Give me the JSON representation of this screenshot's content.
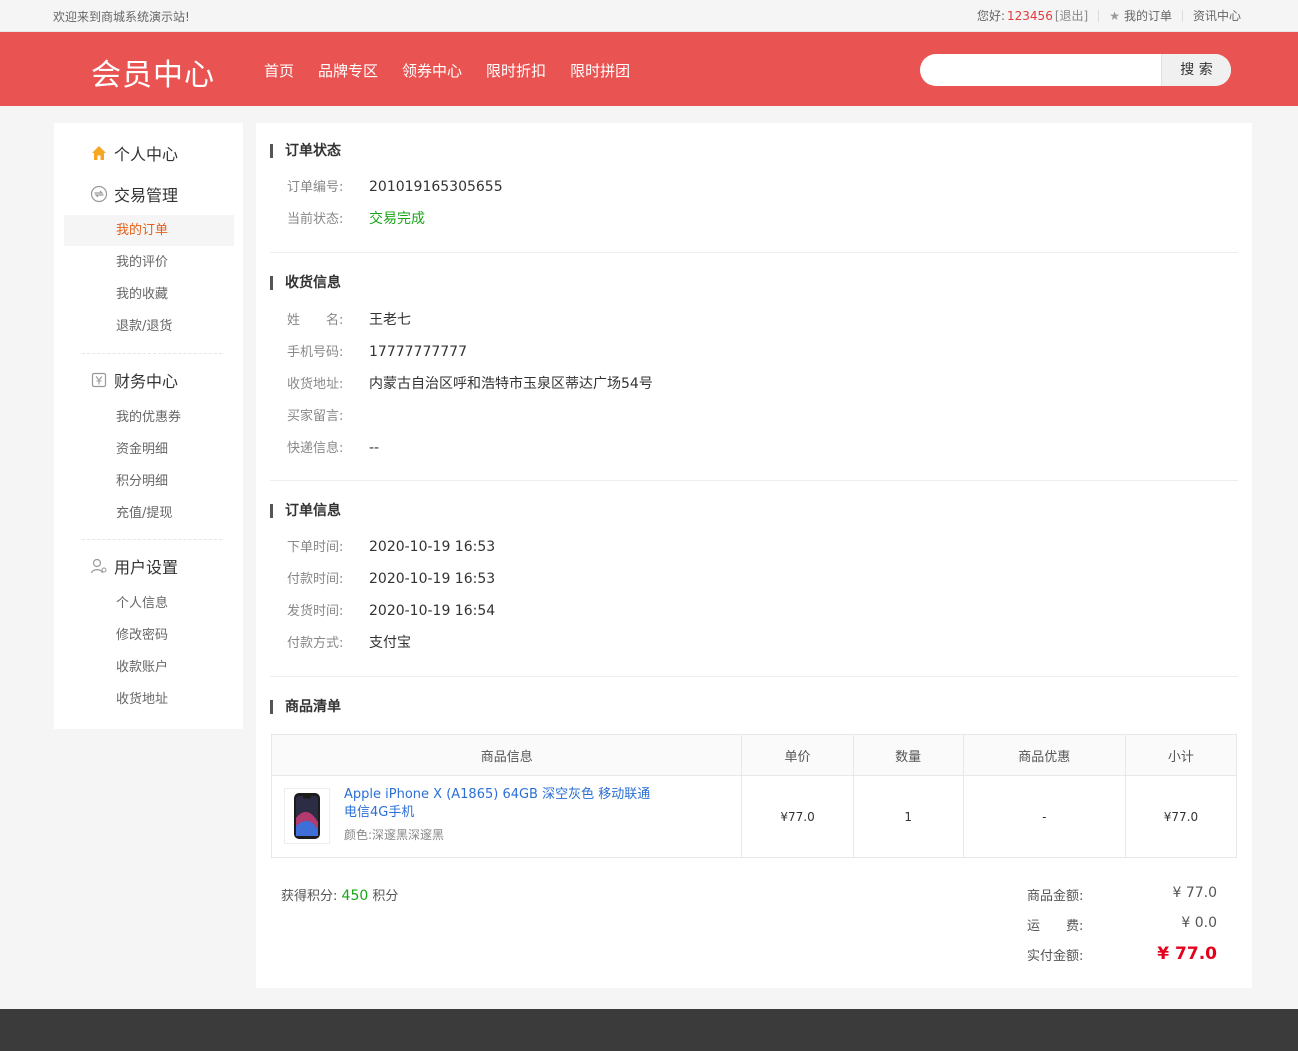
{
  "topbar": {
    "welcome": "欢迎来到商城系统演示站!",
    "greeting": "您好:",
    "username": "123456",
    "logout": "[退出]",
    "my_orders": "我的订单",
    "news": "资讯中心"
  },
  "header": {
    "logo": "会员中心",
    "nav": [
      "首页",
      "品牌专区",
      "领券中心",
      "限时折扣",
      "限时拼团"
    ],
    "search_placeholder": "",
    "search_button": "搜 索",
    "brand_color": "#e95452"
  },
  "sidebar": {
    "groups": [
      {
        "title": "个人中心",
        "icon": "home-icon"
      },
      {
        "title": "交易管理",
        "icon": "exchange-icon",
        "items": [
          "我的订单",
          "我的评价",
          "我的收藏",
          "退款/退货"
        ]
      },
      {
        "title": "财务中心",
        "icon": "finance-icon",
        "items": [
          "我的优惠券",
          "资金明细",
          "积分明细",
          "充值/提现"
        ]
      },
      {
        "title": "用户设置",
        "icon": "user-icon",
        "items": [
          "个人信息",
          "修改密码",
          "收款账户",
          "收货地址"
        ]
      }
    ],
    "active_item": "我的订单"
  },
  "order_status": {
    "title": "订单状态",
    "number_label": "订单编号:",
    "number": "201019165305655",
    "status_label": "当前状态:",
    "status": "交易完成"
  },
  "shipping": {
    "title": "收货信息",
    "name_label": "姓　　名:",
    "name": "王老七",
    "phone_label": "手机号码:",
    "phone": "17777777777",
    "address_label": "收货地址:",
    "address": "内蒙古自治区呼和浩特市玉泉区蒂达广场54号",
    "note_label": "买家留言:",
    "note": "",
    "express_label": "快递信息:",
    "express": "--"
  },
  "order_info": {
    "title": "订单信息",
    "created_label": "下单时间:",
    "created": "2020-10-19 16:53",
    "paid_label": "付款时间:",
    "paid": "2020-10-19 16:53",
    "shipped_label": "发货时间:",
    "shipped": "2020-10-19 16:54",
    "pay_method_label": "付款方式:",
    "pay_method": "支付宝"
  },
  "goods": {
    "title": "商品清单",
    "columns": [
      "商品信息",
      "单价",
      "数量",
      "商品优惠",
      "小计"
    ],
    "rows": [
      {
        "name": "Apple iPhone X (A1865) 64GB 深空灰色 移动联通电信4G手机",
        "spec": "颜色:深邃黑深邃黑",
        "price": "¥77.0",
        "qty": "1",
        "discount": "-",
        "subtotal": "¥77.0"
      }
    ]
  },
  "summary": {
    "points_label": "获得积分:",
    "points": "450",
    "points_unit": "积分",
    "goods_amount_label": "商品金额:",
    "goods_amount": "¥ 77.0",
    "shipping_label": "运　　费:",
    "shipping": "¥ 0.0",
    "paid_label": "实付金额:",
    "paid": "¥ 77.0"
  }
}
